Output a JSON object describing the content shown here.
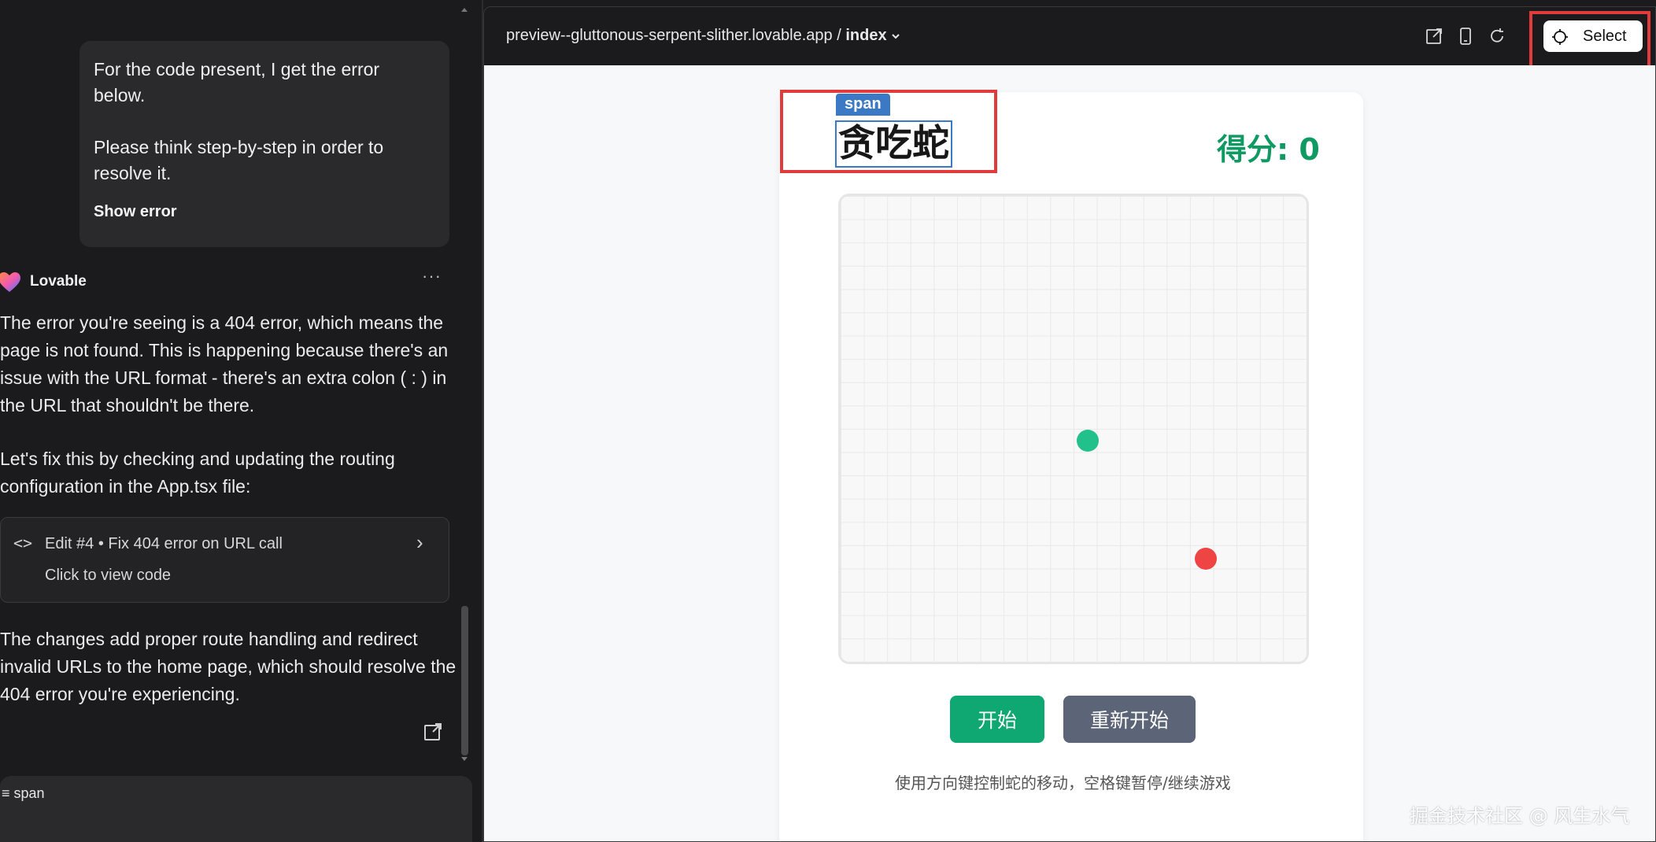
{
  "chat": {
    "user_message": {
      "line1": "For the code present, I get the error below.",
      "line2": "Please think step-by-step in order to resolve it.",
      "show_error": "Show error"
    },
    "assistant": {
      "name": "Lovable",
      "more": "···",
      "paragraph1": "The error you're seeing is a 404 error, which means the page is not found. This is happening because there's an issue with the URL format - there's an extra colon ( : ) in the URL that shouldn't be there.",
      "paragraph2": "Let's fix this by checking and updating the routing configuration in the App.tsx file:",
      "edit_card": {
        "title": "Edit #4 • Fix 404 error on URL call",
        "subtitle": "Click to view code"
      },
      "paragraph3": "The changes add proper route handling and redirect invalid URLs to the home page, which should resolve the 404 error you're experiencing."
    },
    "input": {
      "selected_tag": "span"
    }
  },
  "preview": {
    "url": "preview--gluttonous-serpent-slither.lovable.app",
    "separator": "/",
    "page": "index",
    "select_label": "Select",
    "game": {
      "badge": "span",
      "title": "贪吃蛇",
      "score": "得分: 0",
      "start_button": "开始",
      "restart_button": "重新开始",
      "hint": "使用方向键控制蛇的移动，空格键暂停/继续游戏"
    },
    "watermark": "掘金技术社区 @ 风生水气"
  },
  "colors": {
    "highlight_red": "#e23b3b",
    "score_green": "#0f9a64",
    "start_green": "#10a872",
    "restart_gray": "#5b6577",
    "snake": "#22c08a",
    "food": "#ef4444",
    "badge_blue": "#3b79c4"
  }
}
